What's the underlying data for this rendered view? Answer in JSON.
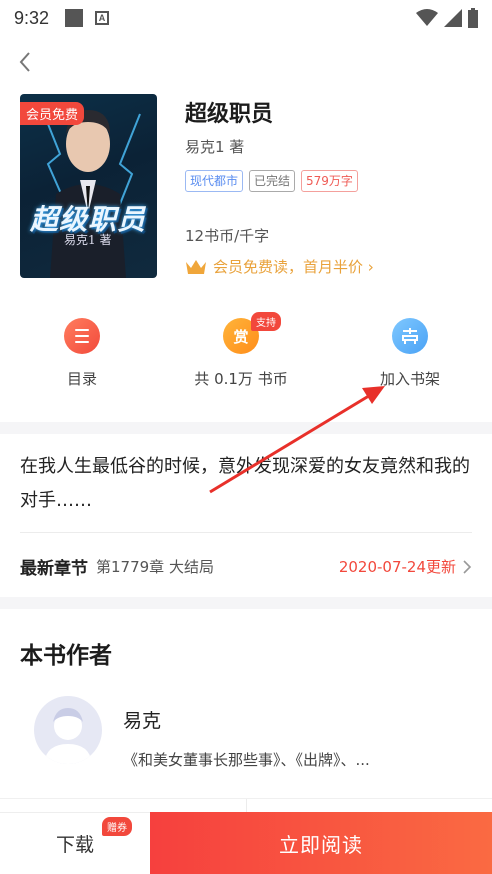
{
  "status_bar": {
    "time": "9:32",
    "notification_glyph": "A"
  },
  "nav": {
    "back_icon": "chevron-left-icon"
  },
  "book": {
    "cover_badge": "会员免费",
    "cover_title": "超级职员",
    "cover_subtitle": "易克1 著",
    "title": "超级职员",
    "author": "易克1 著",
    "tags": [
      "现代都市",
      "已完结",
      "579万字"
    ],
    "price": "12书币/千字",
    "vip_text": "会员免费读，首月半价 ›"
  },
  "actions": {
    "catalog_label": "目录",
    "reward_glyph": "赏",
    "reward_badge": "支持",
    "reward_label": "共 0.1万 书币",
    "shelf_label": "加入书架"
  },
  "description": "在我人生最低谷的时候，意外发现深爱的女友竟然和我的对手……",
  "latest": {
    "label": "最新章节",
    "chapter": "第1779章 大结局",
    "date": "2020-07-24更新"
  },
  "author_section": {
    "heading": "本书作者",
    "name": "易克",
    "works": "《和美女董事长那些事》、《出牌》、..."
  },
  "bottom_bar": {
    "download_label": "下载",
    "gift_badge": "赠券",
    "read_label": "立即阅读"
  },
  "colors": {
    "accent_red": "#f2483c",
    "vip_gold": "#e9a23b",
    "annotation_arrow": "#e8302a"
  }
}
